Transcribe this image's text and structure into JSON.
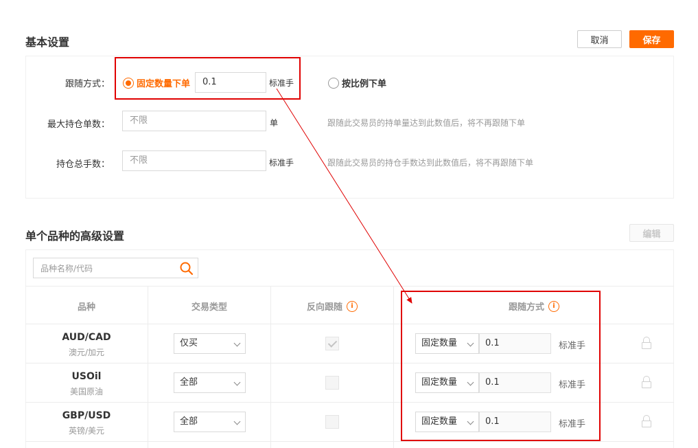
{
  "basic": {
    "title": "基本设置",
    "cancel": "取消",
    "save": "保存",
    "follow_mode_label": "跟随方式：",
    "follow_fixed": "固定数量下单",
    "follow_fixed_value": "0.1",
    "unit_lot": "标准手",
    "follow_ratio": "按比例下单",
    "max_orders_label": "最大持仓单数：",
    "max_orders_placeholder": "不限",
    "unit_order": "单",
    "max_orders_hint": "跟随此交易员的持单量达到此数值后，将不再跟随下单",
    "total_lots_label": "持仓总手数：",
    "total_lots_placeholder": "不限",
    "total_lots_hint": "跟随此交易员的持仓手数达到此数值后，将不再跟随下单"
  },
  "advanced": {
    "title": "单个品种的高级设置",
    "edit": "编辑",
    "search_placeholder": "品种名称/代码",
    "columns": [
      "品种",
      "交易类型",
      "反向跟随",
      "跟随方式"
    ],
    "rows": [
      {
        "code": "AUD/CAD",
        "name": "澳元/加元",
        "trade_type": "仅买",
        "reverse": true,
        "mode": "固定数量",
        "qty": "0.1",
        "unit": "标准手"
      },
      {
        "code": "USOil",
        "name": "美国原油",
        "trade_type": "全部",
        "reverse": false,
        "mode": "固定数量",
        "qty": "0.1",
        "unit": "标准手"
      },
      {
        "code": "GBP/USD",
        "name": "英镑/美元",
        "trade_type": "全部",
        "reverse": false,
        "mode": "固定数量",
        "qty": "0.1",
        "unit": "标准手"
      }
    ]
  },
  "colors": {
    "accent": "#ff6a00",
    "annotation": "#e00000"
  },
  "annotation": {
    "info_icon": "i"
  }
}
